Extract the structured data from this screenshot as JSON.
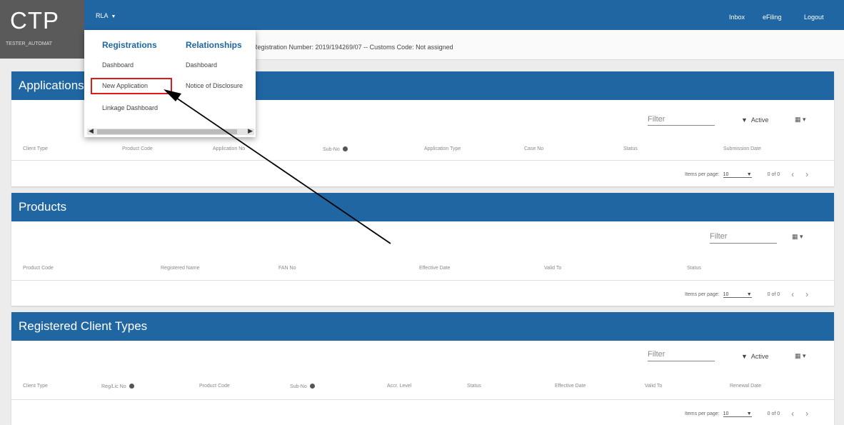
{
  "header": {
    "logo": "CTP",
    "user": "TESTER_AUTOMAT",
    "menu_label": "RLA",
    "links": [
      "Inbox",
      "eFiling",
      "Logout"
    ]
  },
  "registration_text": "Registration Number: 2019/194269/07 -- Customs Code: Not assigned",
  "menu": {
    "registrations": {
      "title": "Registrations",
      "items": [
        "Dashboard",
        "New Application",
        "Linkage Dashboard"
      ]
    },
    "relationships": {
      "title": "Relationships",
      "items": [
        "Dashboard",
        "Notice of Disclosure"
      ]
    }
  },
  "applications": {
    "title": "Applications",
    "filter_label": "Filter",
    "status_filter": "Active",
    "columns": [
      "Client Type",
      "Product Code",
      "Application No",
      "Sub-No",
      "Application Type",
      "Case No",
      "Status",
      "Submission Date"
    ],
    "pager": {
      "label": "Items per page:",
      "size": "10",
      "range": "0 of 0"
    }
  },
  "products": {
    "title": "Products",
    "filter_label": "Filter",
    "columns": [
      "Product Code",
      "Registered Name",
      "FAN No",
      "Effective Date",
      "Valid To",
      "Status"
    ],
    "pager": {
      "label": "Items per page:",
      "size": "10",
      "range": "0 of 0"
    }
  },
  "client_types": {
    "title": "Registered Client Types",
    "filter_label": "Filter",
    "status_filter": "Active",
    "columns": [
      "Client Type",
      "Reg/Lic No",
      "Product Code",
      "Sub-No",
      "Accr. Level",
      "Status",
      "Effective Date",
      "Valid To",
      "Renewal Date"
    ],
    "pager": {
      "label": "Items per page:",
      "size": "10",
      "range": "0 of 0"
    }
  },
  "colors": {
    "primary": "#1f66a3",
    "highlight": "#e0191b",
    "logo_bg": "#5a5a5a"
  }
}
